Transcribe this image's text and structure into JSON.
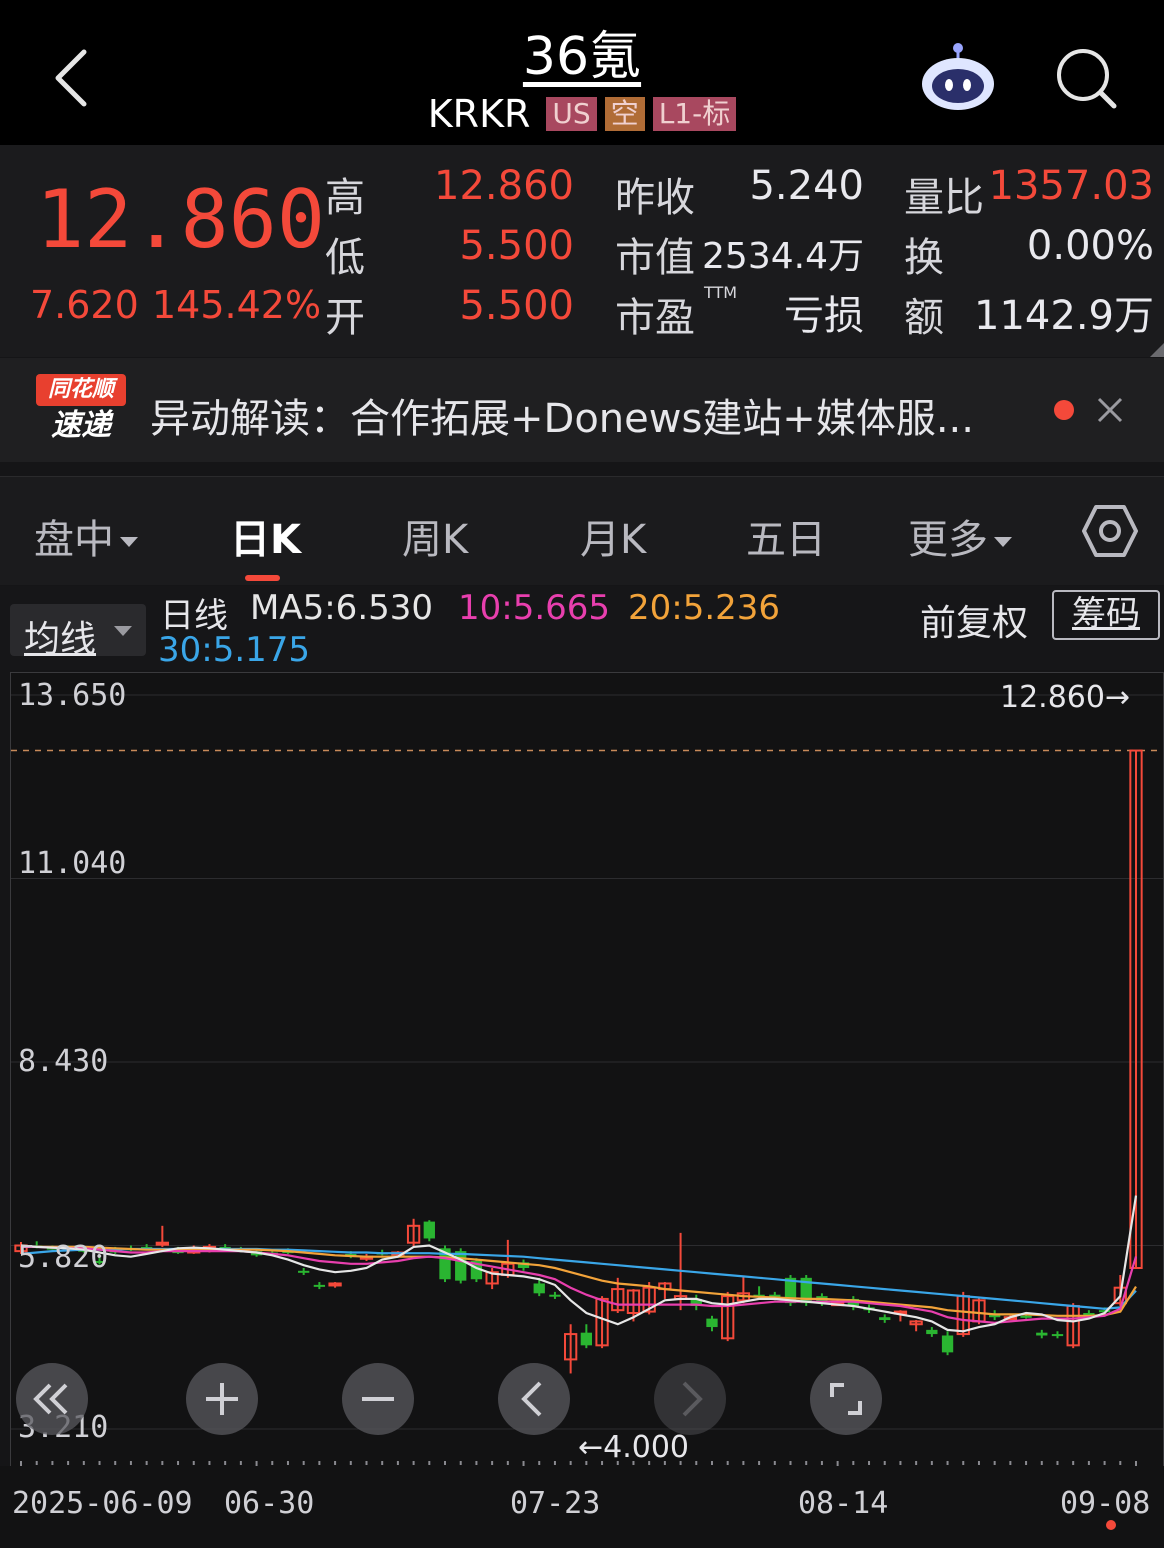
{
  "header": {
    "title": "36氪",
    "ticker": "KRKR",
    "tags": [
      {
        "label": "US",
        "color": "#a8485f"
      },
      {
        "label": "空",
        "color": "#b06c36"
      },
      {
        "label": "L1-标",
        "color": "#a8485f"
      }
    ]
  },
  "quote": {
    "price": "12.860",
    "change": "7.620",
    "change_pct": "145.42%",
    "high_label": "高",
    "high": "12.860",
    "low_label": "低",
    "low": "5.500",
    "open_label": "开",
    "open": "5.500",
    "prev_close_label": "昨收",
    "prev_close": "5.240",
    "mkt_cap_label": "市值",
    "mkt_cap": "2534.4万",
    "pe_label": "市盈",
    "pe_sup": "TTM",
    "pe": "亏损",
    "vol_ratio_label": "量比",
    "vol_ratio": "1357.03",
    "turnover_label": "换",
    "turnover": "0.00%",
    "amount_label": "额",
    "amount": "1142.9万"
  },
  "news": {
    "logo_top": "同花顺",
    "logo_bottom": "速递",
    "text": "异动解读：合作拓展+Donews建站+媒体服..."
  },
  "tabs": [
    {
      "label": "盘中"
    },
    {
      "label": "日K"
    },
    {
      "label": "周K"
    },
    {
      "label": "月K"
    },
    {
      "label": "五日"
    },
    {
      "label": "更多"
    }
  ],
  "indicators": {
    "selector": "均线",
    "period": "日线",
    "ma5": "MA5:6.530",
    "ma10": "10:5.665",
    "ma20": "20:5.236",
    "ma30": "30:5.175",
    "adjust": "前复权",
    "chips": "筹码",
    "colors": {
      "ma5": "#e6e6e6",
      "ma10": "#e83fae",
      "ma20": "#f2a33a",
      "ma30": "#3aa6e8",
      "up": "#f4493a",
      "down": "#2ab531"
    }
  },
  "chart_data": {
    "type": "candlestick",
    "y_ticks": [
      "13.650",
      "11.040",
      "8.430",
      "5.820",
      "3.210"
    ],
    "ylim": [
      3.21,
      13.65
    ],
    "x_ticks": [
      "2025-06-09",
      "06-30",
      "07-23",
      "08-14",
      "09-08"
    ],
    "last_price_marker": "12.860→",
    "low_marker": "←4.000",
    "candles": [
      [
        5.74,
        5.87,
        5.7,
        5.82
      ],
      [
        5.82,
        5.88,
        5.78,
        5.8
      ],
      [
        5.79,
        5.82,
        5.76,
        5.78
      ],
      [
        5.78,
        5.82,
        5.74,
        5.76
      ],
      [
        5.76,
        5.8,
        5.72,
        5.75
      ],
      [
        5.6,
        5.65,
        5.55,
        5.58
      ],
      [
        5.75,
        5.8,
        5.7,
        5.72
      ],
      [
        5.78,
        5.82,
        5.74,
        5.75
      ],
      [
        5.8,
        5.84,
        5.76,
        5.77
      ],
      [
        5.84,
        6.1,
        5.8,
        5.86
      ],
      [
        5.74,
        5.8,
        5.7,
        5.72
      ],
      [
        5.72,
        5.82,
        5.7,
        5.78
      ],
      [
        5.76,
        5.84,
        5.72,
        5.8
      ],
      [
        5.8,
        5.84,
        5.74,
        5.78
      ],
      [
        5.76,
        5.8,
        5.72,
        5.74
      ],
      [
        5.74,
        5.78,
        5.66,
        5.68
      ],
      [
        5.72,
        5.76,
        5.68,
        5.7
      ],
      [
        5.74,
        5.78,
        5.7,
        5.72
      ],
      [
        5.46,
        5.5,
        5.4,
        5.44
      ],
      [
        5.26,
        5.3,
        5.2,
        5.24
      ],
      [
        5.26,
        5.3,
        5.22,
        5.28
      ],
      [
        5.7,
        5.74,
        5.64,
        5.66
      ],
      [
        5.64,
        5.7,
        5.6,
        5.66
      ],
      [
        5.72,
        5.76,
        5.68,
        5.7
      ],
      [
        5.7,
        5.74,
        5.66,
        5.72
      ],
      [
        5.86,
        6.2,
        5.8,
        6.1
      ],
      [
        6.16,
        6.18,
        5.88,
        5.92
      ],
      [
        5.78,
        5.82,
        5.3,
        5.34
      ],
      [
        5.74,
        5.78,
        5.28,
        5.32
      ],
      [
        5.6,
        5.64,
        5.3,
        5.34
      ],
      [
        5.28,
        5.5,
        5.2,
        5.44
      ],
      [
        5.4,
        5.9,
        5.36,
        5.56
      ],
      [
        5.58,
        5.62,
        5.46,
        5.5
      ],
      [
        5.28,
        5.36,
        5.1,
        5.14
      ],
      [
        5.12,
        5.16,
        5.06,
        5.1
      ],
      [
        4.2,
        4.7,
        4.0,
        4.56
      ],
      [
        4.58,
        4.7,
        4.36,
        4.4
      ],
      [
        4.4,
        5.1,
        4.36,
        5.06
      ],
      [
        4.9,
        5.36,
        4.86,
        5.2
      ],
      [
        4.86,
        5.2,
        4.74,
        5.18
      ],
      [
        4.88,
        5.3,
        4.84,
        5.22
      ],
      [
        5.2,
        5.3,
        5.06,
        5.28
      ],
      [
        5.06,
        6.0,
        4.9,
        5.1
      ],
      [
        5.06,
        5.12,
        4.9,
        4.96
      ],
      [
        4.78,
        4.82,
        4.6,
        4.66
      ],
      [
        4.5,
        5.16,
        4.46,
        5.1
      ],
      [
        5.04,
        5.38,
        5.0,
        5.14
      ],
      [
        5.12,
        5.24,
        5.06,
        5.08
      ],
      [
        5.12,
        5.16,
        5.04,
        5.06
      ],
      [
        5.36,
        5.4,
        4.96,
        5.0
      ],
      [
        5.36,
        5.4,
        4.96,
        5.0
      ],
      [
        5.1,
        5.14,
        4.96,
        5.02
      ],
      [
        5.0,
        5.04,
        4.96,
        5.0
      ],
      [
        5.06,
        5.1,
        4.9,
        4.96
      ],
      [
        4.94,
        4.98,
        4.86,
        4.9
      ],
      [
        4.8,
        4.84,
        4.72,
        4.76
      ],
      [
        4.86,
        4.9,
        4.74,
        4.88
      ],
      [
        4.7,
        4.76,
        4.6,
        4.74
      ],
      [
        4.62,
        4.66,
        4.52,
        4.56
      ],
      [
        4.54,
        4.6,
        4.26,
        4.3
      ],
      [
        4.56,
        5.16,
        4.52,
        5.1
      ],
      [
        4.74,
        5.08,
        4.7,
        5.04
      ],
      [
        4.84,
        4.9,
        4.76,
        4.8
      ],
      [
        4.8,
        4.84,
        4.76,
        4.8
      ],
      [
        4.82,
        4.86,
        4.78,
        4.8
      ],
      [
        4.58,
        4.62,
        4.5,
        4.54
      ],
      [
        4.56,
        4.6,
        4.5,
        4.54
      ],
      [
        4.4,
        5.0,
        4.36,
        4.96
      ],
      [
        4.86,
        4.9,
        4.8,
        4.84
      ],
      [
        4.9,
        4.94,
        4.84,
        4.88
      ],
      [
        5.0,
        5.4,
        4.96,
        5.22
      ],
      [
        5.5,
        12.86,
        5.5,
        12.86
      ]
    ],
    "ma5": [
      5.82,
      5.8,
      5.79,
      5.78,
      5.76,
      5.72,
      5.68,
      5.66,
      5.7,
      5.74,
      5.78,
      5.79,
      5.78,
      5.76,
      5.74,
      5.72,
      5.68,
      5.62,
      5.54,
      5.48,
      5.44,
      5.46,
      5.5,
      5.62,
      5.66,
      5.8,
      5.82,
      5.72,
      5.62,
      5.5,
      5.42,
      5.4,
      5.38,
      5.34,
      5.26,
      5.04,
      4.86,
      4.78,
      4.7,
      4.8,
      4.92,
      5.04,
      5.06,
      5.06,
      5.0,
      4.98,
      5.02,
      5.06,
      5.06,
      5.04,
      5.02,
      5.0,
      4.98,
      4.96,
      4.92,
      4.88,
      4.84,
      4.8,
      4.74,
      4.62,
      4.6,
      4.66,
      4.7,
      4.8,
      4.86,
      4.84,
      4.76,
      4.74,
      4.78,
      4.86,
      5.1,
      6.53
    ],
    "ma10": [
      5.8,
      5.8,
      5.79,
      5.78,
      5.78,
      5.76,
      5.74,
      5.72,
      5.72,
      5.74,
      5.74,
      5.74,
      5.74,
      5.74,
      5.74,
      5.72,
      5.7,
      5.68,
      5.64,
      5.6,
      5.58,
      5.56,
      5.56,
      5.58,
      5.6,
      5.64,
      5.66,
      5.64,
      5.6,
      5.56,
      5.52,
      5.48,
      5.44,
      5.4,
      5.34,
      5.22,
      5.12,
      5.04,
      4.98,
      4.98,
      4.98,
      4.98,
      4.98,
      4.98,
      4.96,
      4.96,
      4.98,
      5.0,
      5.02,
      5.02,
      5.02,
      5.02,
      5.02,
      5.02,
      5.0,
      4.98,
      4.96,
      4.92,
      4.88,
      4.8,
      4.76,
      4.74,
      4.72,
      4.74,
      4.76,
      4.78,
      4.78,
      4.78,
      4.8,
      4.82,
      4.92,
      5.665
    ],
    "ma20": [
      5.8,
      5.8,
      5.8,
      5.8,
      5.8,
      5.79,
      5.78,
      5.77,
      5.76,
      5.76,
      5.76,
      5.76,
      5.76,
      5.76,
      5.76,
      5.76,
      5.75,
      5.74,
      5.72,
      5.7,
      5.68,
      5.67,
      5.66,
      5.66,
      5.66,
      5.66,
      5.66,
      5.65,
      5.64,
      5.62,
      5.6,
      5.58,
      5.56,
      5.54,
      5.5,
      5.44,
      5.38,
      5.32,
      5.28,
      5.26,
      5.24,
      5.2,
      5.18,
      5.16,
      5.14,
      5.12,
      5.1,
      5.09,
      5.08,
      5.07,
      5.06,
      5.06,
      5.05,
      5.04,
      5.02,
      5.0,
      4.98,
      4.96,
      4.94,
      4.9,
      4.88,
      4.86,
      4.84,
      4.84,
      4.84,
      4.83,
      4.82,
      4.82,
      4.82,
      4.83,
      4.88,
      5.236
    ],
    "ma30": [
      5.7,
      5.72,
      5.74,
      5.75,
      5.76,
      5.76,
      5.76,
      5.77,
      5.77,
      5.77,
      5.77,
      5.77,
      5.77,
      5.77,
      5.77,
      5.77,
      5.76,
      5.76,
      5.75,
      5.74,
      5.73,
      5.72,
      5.72,
      5.71,
      5.71,
      5.71,
      5.71,
      5.7,
      5.7,
      5.69,
      5.68,
      5.67,
      5.66,
      5.64,
      5.62,
      5.6,
      5.58,
      5.56,
      5.54,
      5.52,
      5.5,
      5.48,
      5.46,
      5.44,
      5.42,
      5.4,
      5.38,
      5.36,
      5.34,
      5.32,
      5.3,
      5.28,
      5.26,
      5.24,
      5.22,
      5.2,
      5.18,
      5.16,
      5.14,
      5.12,
      5.1,
      5.08,
      5.06,
      5.04,
      5.02,
      5.0,
      4.98,
      4.96,
      4.94,
      4.92,
      4.94,
      5.175
    ]
  },
  "controls": [
    {
      "icon": "double-chevron-left"
    },
    {
      "icon": "plus"
    },
    {
      "icon": "minus"
    },
    {
      "icon": "chevron-left"
    },
    {
      "icon": "chevron-right"
    },
    {
      "icon": "fullscreen"
    }
  ]
}
